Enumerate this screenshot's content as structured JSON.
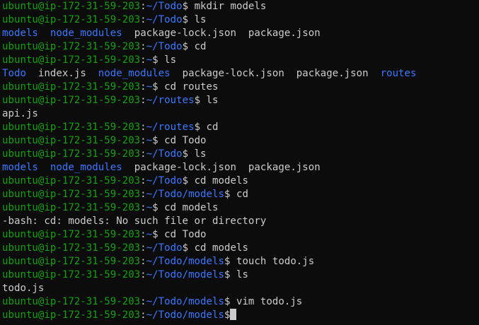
{
  "window": {
    "type": "terminal",
    "colors": {
      "background": "#0c0c0c",
      "text": "#cccccc",
      "prompt_user": "#13a10e",
      "prompt_path": "#3b78ff",
      "directory": "#3b78ff"
    }
  },
  "lines": [
    [
      {
        "t": "ubuntu@ip-172-31-59-203",
        "c": "user"
      },
      {
        "t": ":",
        "c": "text"
      },
      {
        "t": "~/Todo",
        "c": "path"
      },
      {
        "t": "$ mkdir models",
        "c": "text"
      }
    ],
    [
      {
        "t": "ubuntu@ip-172-31-59-203",
        "c": "user"
      },
      {
        "t": ":",
        "c": "text"
      },
      {
        "t": "~/Todo",
        "c": "path"
      },
      {
        "t": "$ ls",
        "c": "text"
      }
    ],
    [
      {
        "t": "models",
        "c": "dir"
      },
      {
        "t": "  ",
        "c": "text"
      },
      {
        "t": "node_modules",
        "c": "dir"
      },
      {
        "t": "  package-lock.json  package.json",
        "c": "text"
      }
    ],
    [
      {
        "t": "ubuntu@ip-172-31-59-203",
        "c": "user"
      },
      {
        "t": ":",
        "c": "text"
      },
      {
        "t": "~/Todo",
        "c": "path"
      },
      {
        "t": "$ cd",
        "c": "text"
      }
    ],
    [
      {
        "t": "ubuntu@ip-172-31-59-203",
        "c": "user"
      },
      {
        "t": ":",
        "c": "text"
      },
      {
        "t": "~",
        "c": "path"
      },
      {
        "t": "$ ls",
        "c": "text"
      }
    ],
    [
      {
        "t": "Todo",
        "c": "dir"
      },
      {
        "t": "  index.js  ",
        "c": "text"
      },
      {
        "t": "node_modules",
        "c": "dir"
      },
      {
        "t": "  package-lock.json  package.json  ",
        "c": "text"
      },
      {
        "t": "routes",
        "c": "dir"
      }
    ],
    [
      {
        "t": "ubuntu@ip-172-31-59-203",
        "c": "user"
      },
      {
        "t": ":",
        "c": "text"
      },
      {
        "t": "~",
        "c": "path"
      },
      {
        "t": "$ cd routes",
        "c": "text"
      }
    ],
    [
      {
        "t": "ubuntu@ip-172-31-59-203",
        "c": "user"
      },
      {
        "t": ":",
        "c": "text"
      },
      {
        "t": "~/routes",
        "c": "path"
      },
      {
        "t": "$ ls",
        "c": "text"
      }
    ],
    [
      {
        "t": "api.js",
        "c": "text"
      }
    ],
    [
      {
        "t": "ubuntu@ip-172-31-59-203",
        "c": "user"
      },
      {
        "t": ":",
        "c": "text"
      },
      {
        "t": "~/routes",
        "c": "path"
      },
      {
        "t": "$ cd",
        "c": "text"
      }
    ],
    [
      {
        "t": "ubuntu@ip-172-31-59-203",
        "c": "user"
      },
      {
        "t": ":",
        "c": "text"
      },
      {
        "t": "~",
        "c": "path"
      },
      {
        "t": "$ cd Todo",
        "c": "text"
      }
    ],
    [
      {
        "t": "ubuntu@ip-172-31-59-203",
        "c": "user"
      },
      {
        "t": ":",
        "c": "text"
      },
      {
        "t": "~/Todo",
        "c": "path"
      },
      {
        "t": "$ ls",
        "c": "text"
      }
    ],
    [
      {
        "t": "models",
        "c": "dir"
      },
      {
        "t": "  ",
        "c": "text"
      },
      {
        "t": "node_modules",
        "c": "dir"
      },
      {
        "t": "  package-lock.json  package.json",
        "c": "text"
      }
    ],
    [
      {
        "t": "ubuntu@ip-172-31-59-203",
        "c": "user"
      },
      {
        "t": ":",
        "c": "text"
      },
      {
        "t": "~/Todo",
        "c": "path"
      },
      {
        "t": "$ cd models",
        "c": "text"
      }
    ],
    [
      {
        "t": "ubuntu@ip-172-31-59-203",
        "c": "user"
      },
      {
        "t": ":",
        "c": "text"
      },
      {
        "t": "~/Todo/models",
        "c": "path"
      },
      {
        "t": "$ cd",
        "c": "text"
      }
    ],
    [
      {
        "t": "ubuntu@ip-172-31-59-203",
        "c": "user"
      },
      {
        "t": ":",
        "c": "text"
      },
      {
        "t": "~",
        "c": "path"
      },
      {
        "t": "$ cd models",
        "c": "text"
      }
    ],
    [
      {
        "t": "-bash: cd: models: No such file or directory",
        "c": "text"
      }
    ],
    [
      {
        "t": "ubuntu@ip-172-31-59-203",
        "c": "user"
      },
      {
        "t": ":",
        "c": "text"
      },
      {
        "t": "~",
        "c": "path"
      },
      {
        "t": "$ cd Todo",
        "c": "text"
      }
    ],
    [
      {
        "t": "ubuntu@ip-172-31-59-203",
        "c": "user"
      },
      {
        "t": ":",
        "c": "text"
      },
      {
        "t": "~/Todo",
        "c": "path"
      },
      {
        "t": "$ cd models",
        "c": "text"
      }
    ],
    [
      {
        "t": "ubuntu@ip-172-31-59-203",
        "c": "user"
      },
      {
        "t": ":",
        "c": "text"
      },
      {
        "t": "~/Todo/models",
        "c": "path"
      },
      {
        "t": "$ touch todo.js",
        "c": "text"
      }
    ],
    [
      {
        "t": "ubuntu@ip-172-31-59-203",
        "c": "user"
      },
      {
        "t": ":",
        "c": "text"
      },
      {
        "t": "~/Todo/models",
        "c": "path"
      },
      {
        "t": "$ ls",
        "c": "text"
      }
    ],
    [
      {
        "t": "todo.js",
        "c": "text"
      }
    ],
    [
      {
        "t": "ubuntu@ip-172-31-59-203",
        "c": "user"
      },
      {
        "t": ":",
        "c": "text"
      },
      {
        "t": "~/Todo/models",
        "c": "path"
      },
      {
        "t": "$ vim todo.js",
        "c": "text"
      }
    ],
    [
      {
        "t": "ubuntu@ip-172-31-59-203",
        "c": "user"
      },
      {
        "t": ":",
        "c": "text"
      },
      {
        "t": "~/Todo/models",
        "c": "path"
      },
      {
        "t": "$",
        "c": "text"
      }
    ]
  ]
}
